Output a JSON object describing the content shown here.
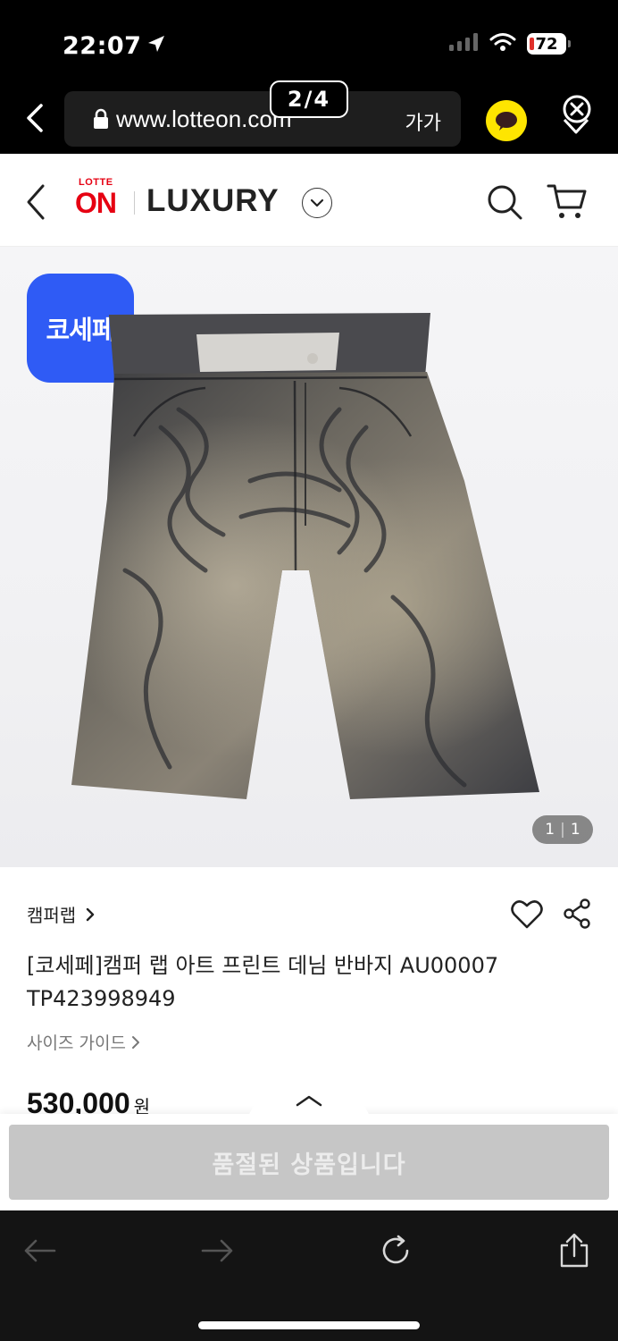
{
  "status_bar": {
    "time": "22:07",
    "battery": "72"
  },
  "browser": {
    "url": "www.lotteon.com",
    "text_size_label": "가가",
    "page_counter": "2/4"
  },
  "site_header": {
    "logo_top": "LOTTE",
    "logo_main": "ON",
    "section": "LUXURY"
  },
  "product_image": {
    "badge": "코세페",
    "counter_current": "1",
    "counter_total": "1"
  },
  "product": {
    "brand": "캠퍼랩",
    "title": "[코세페]캠퍼 랩 아트 프린트 데님 반바지 AU00007 TP423998949",
    "size_guide": "사이즈 가이드",
    "price": "530,000",
    "price_unit": "원"
  },
  "purchase": {
    "soldout_label": "품절된 상품입니다"
  },
  "colors": {
    "lotte_red": "#e60012",
    "badge_blue": "#2f5bf5",
    "kakao_yellow": "#fee500",
    "soldout_gray": "#c6c6c6"
  },
  "icons": {
    "status": [
      "location-arrow-icon",
      "signal-icon",
      "wifi-icon",
      "battery-icon"
    ],
    "browser": [
      "back-icon",
      "lock-icon",
      "kakao-talk-icon",
      "close-pin-icon"
    ],
    "header": [
      "back-icon",
      "chevron-down-icon",
      "search-icon",
      "cart-icon"
    ],
    "product": [
      "heart-icon",
      "share-icon",
      "chevron-right-icon",
      "chevron-up-icon"
    ],
    "toolbar": [
      "arrow-left-icon",
      "arrow-right-icon",
      "refresh-icon",
      "share-upload-icon"
    ]
  }
}
